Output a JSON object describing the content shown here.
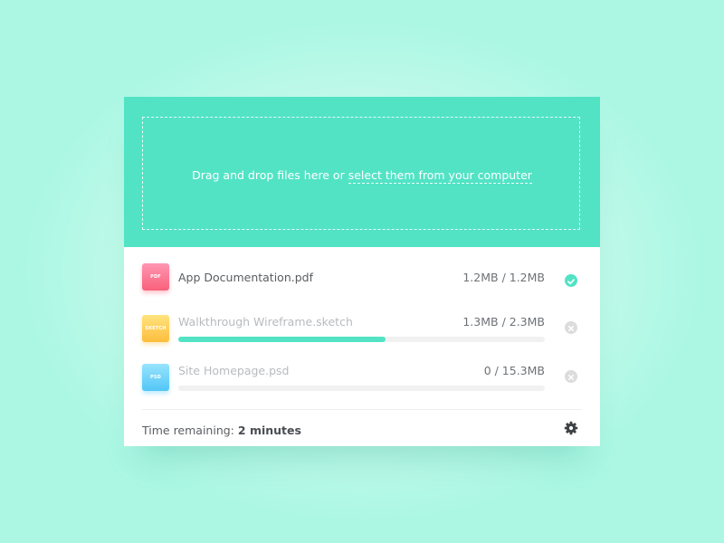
{
  "dropzone": {
    "text": "Drag and drop files here or",
    "link": "select them from your computer"
  },
  "files": [
    {
      "name": "App Documentation.pdf",
      "size": "1.2MB / 1.2MB",
      "type_label": "PDF",
      "icon": "pdf-file-icon",
      "status": "complete",
      "status_icon": "checkmark-icon"
    },
    {
      "name": "Walkthrough Wireframe.sketch",
      "size": "1.3MB / 2.3MB",
      "type_label": "SKETCH",
      "icon": "sketch-file-icon",
      "status": "uploading",
      "progress": 0.565,
      "status_icon": "cancel-icon"
    },
    {
      "name": "Site Homepage.psd",
      "size": "0 / 15.3MB",
      "type_label": "PSD",
      "icon": "psd-file-icon",
      "status": "queued",
      "progress": 0,
      "status_icon": "cancel-icon"
    }
  ],
  "footer": {
    "label": "Time remaining:",
    "value": "2 minutes"
  },
  "colors": {
    "accent": "#52e3c5",
    "pdf": "#f9617a",
    "sketch": "#fdbd3d",
    "psd": "#52c6f6"
  }
}
